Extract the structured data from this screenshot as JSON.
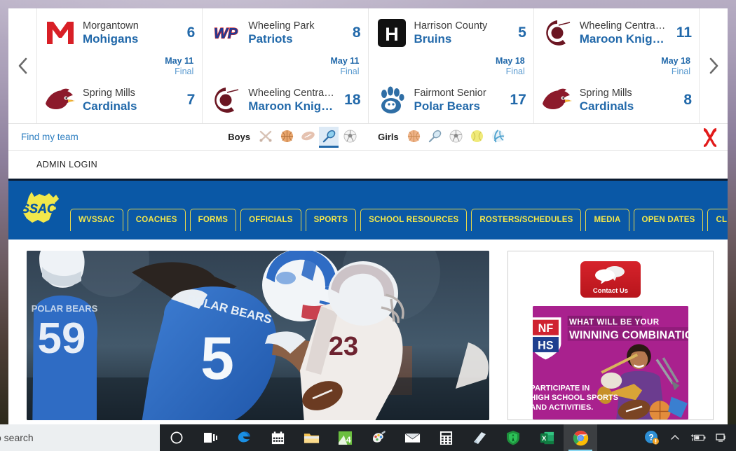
{
  "scoreboard": {
    "prev_arrow": "chevron-left",
    "next_arrow": "chevron-right",
    "games": [
      {
        "away": {
          "city": "Morgantown",
          "mascot": "Mohigans",
          "score": "6",
          "logo": "morgantown-m-logo"
        },
        "home": {
          "city": "Spring Mills",
          "mascot": "Cardinals",
          "score": "7",
          "logo": "cardinal-head-logo"
        },
        "date": "May 11",
        "status": "Final"
      },
      {
        "away": {
          "city": "Wheeling Park",
          "mascot": "Patriots",
          "score": "8",
          "logo": "wheeling-park-wp-logo"
        },
        "home": {
          "city": "Wheeling Central ...",
          "mascot": "Maroon Knights",
          "score": "18",
          "logo": "wheeling-central-c-logo"
        },
        "date": "May 11",
        "status": "Final"
      },
      {
        "away": {
          "city": "Harrison County",
          "mascot": "Bruins",
          "score": "5",
          "logo": "harrison-county-h-logo"
        },
        "home": {
          "city": "Fairmont Senior",
          "mascot": "Polar Bears",
          "score": "17",
          "logo": "polar-bear-paw-logo"
        },
        "date": "May 18",
        "status": "Final"
      },
      {
        "away": {
          "city": "Wheeling Central ...",
          "mascot": "Maroon Knights",
          "score": "11",
          "logo": "wheeling-central-c-logo"
        },
        "home": {
          "city": "Spring Mills",
          "mascot": "Cardinals",
          "score": "8",
          "logo": "cardinal-head-logo"
        },
        "date": "May 18",
        "status": "Final"
      }
    ]
  },
  "sportsbar": {
    "find_my_team": "Find my team",
    "boys_label": "Boys",
    "girls_label": "Girls",
    "boys_sports": [
      {
        "name": "baseball-icon",
        "selected": false
      },
      {
        "name": "basketball-icon",
        "selected": false
      },
      {
        "name": "football-icon",
        "selected": false
      },
      {
        "name": "lacrosse-icon",
        "selected": true
      },
      {
        "name": "soccer-icon",
        "selected": false
      }
    ],
    "girls_sports": [
      {
        "name": "basketball-icon",
        "selected": false
      },
      {
        "name": "lacrosse-icon",
        "selected": false
      },
      {
        "name": "soccer-icon",
        "selected": false
      },
      {
        "name": "softball-icon",
        "selected": false
      },
      {
        "name": "volleyball-icon",
        "selected": false
      }
    ],
    "brand_logo": "maxpreps-x-logo"
  },
  "admin": {
    "login_label": "ADMIN LOGIN"
  },
  "site_nav": {
    "logo_text": "SSAC",
    "items": [
      "WVSSAC",
      "COACHES",
      "FORMS",
      "OFFICIALS",
      "SPORTS",
      "SCHOOL RESOURCES",
      "ROSTERS/SCHEDULES",
      "MEDIA",
      "OPEN DATES",
      "CLINICS"
    ]
  },
  "main": {
    "hero_photo": "football-action-photo",
    "hero_jersey_number": "5",
    "hero_jersey_text": "POLAR BEARS",
    "hero_lineman_number": "59",
    "hero_opponent_number": "23"
  },
  "sidebar": {
    "contact": {
      "label": "Contact Us",
      "icon": "chat-bubbles-icon"
    },
    "ad": {
      "name": "nfhs-winning-combination-ad",
      "brand": "NFHS",
      "headline_line1": "WHAT WILL BE YOUR",
      "headline_line2": "WINNING COMBINATION?",
      "body_line1": "PARTICIPATE IN",
      "body_line2": "HIGH SCHOOL SPORTS",
      "body_line3": "AND ACTIVITIES."
    }
  },
  "taskbar": {
    "search_text": "o search",
    "items": [
      {
        "name": "cortana-icon",
        "active": false
      },
      {
        "name": "task-view-icon",
        "active": false
      },
      {
        "name": "microsoft-edge-icon",
        "active": false
      },
      {
        "name": "calendar-icon",
        "active": false
      },
      {
        "name": "file-explorer-icon",
        "active": false
      },
      {
        "name": "green-4-app-icon",
        "active": false
      },
      {
        "name": "paint-icon",
        "active": false
      },
      {
        "name": "mail-icon",
        "active": false
      },
      {
        "name": "calculator-icon",
        "active": false
      },
      {
        "name": "sticky-notes-icon",
        "active": false
      },
      {
        "name": "antivirus-shield-icon",
        "active": false
      },
      {
        "name": "excel-icon",
        "active": false
      },
      {
        "name": "google-chrome-icon",
        "active": true
      }
    ],
    "tray": [
      {
        "name": "help-question-icon"
      },
      {
        "name": "show-hidden-icons-chevron"
      },
      {
        "name": "battery-charging-icon"
      },
      {
        "name": "network-icon"
      }
    ]
  },
  "colors": {
    "nav_blue": "#0a58a6",
    "nav_yellow": "#f2e84b",
    "score_blue": "#2269aa",
    "accent_red": "#d6232b",
    "ad_magenta": "#a9218e"
  }
}
